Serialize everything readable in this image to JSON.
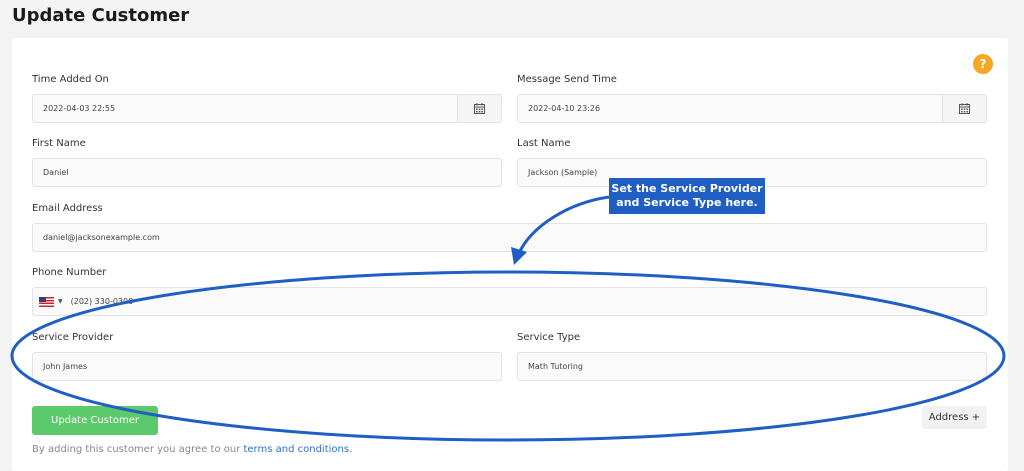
{
  "page": {
    "title": "Update Customer"
  },
  "help": {
    "label": "?"
  },
  "fields": {
    "time_added": {
      "label": "Time Added On",
      "value": "2022-04-03 22:55"
    },
    "message_send": {
      "label": "Message Send Time",
      "value": "2022-04-10 23:26"
    },
    "first_name": {
      "label": "First Name",
      "value": "Daniel"
    },
    "last_name": {
      "label": "Last Name",
      "value": "Jackson (Sample)"
    },
    "email": {
      "label": "Email Address",
      "value": "daniel@jacksonexample.com"
    },
    "phone": {
      "label": "Phone Number",
      "value": "(202) 330-0300",
      "country": "US"
    },
    "service_provider": {
      "label": "Service Provider",
      "value": "John James"
    },
    "service_type": {
      "label": "Service Type",
      "value": "Math Tutoring"
    }
  },
  "actions": {
    "update_label": "Update Customer",
    "address_label": "Address +"
  },
  "terms": {
    "prefix": "By adding this customer you agree to our ",
    "link": "terms and conditions",
    "suffix": "."
  },
  "annotation": {
    "line1": "Set the Service Provider",
    "line2": "and Service Type here."
  },
  "colors": {
    "accent_green": "#5cc96b",
    "annotation_blue": "#1f5fc4",
    "help_orange": "#f5a623",
    "link_blue": "#2e6fcf"
  },
  "icons": [
    "calendar-icon",
    "us-flag-icon",
    "chevron-down-icon",
    "question-icon"
  ]
}
